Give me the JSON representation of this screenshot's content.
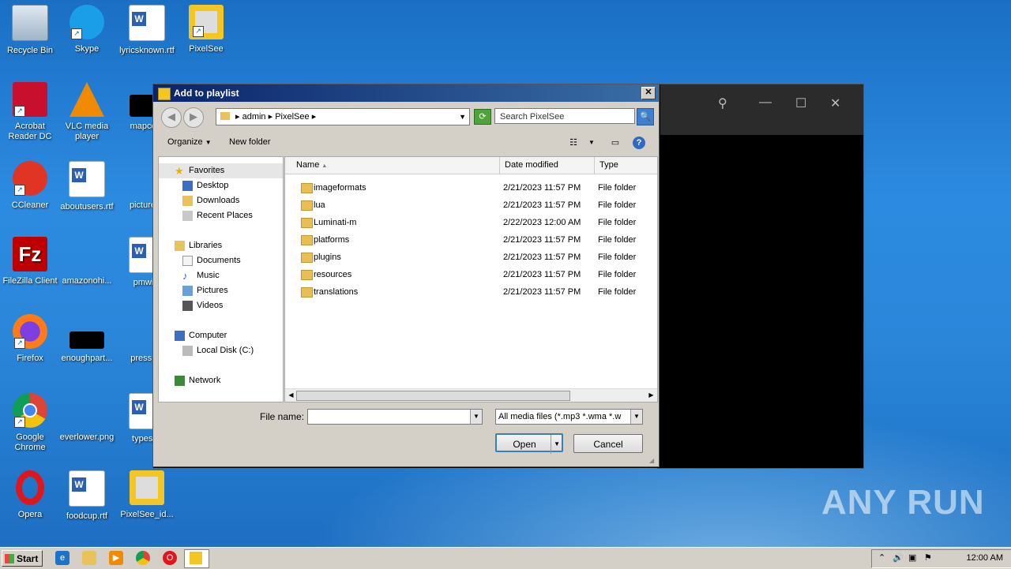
{
  "desktop": {
    "icons": [
      {
        "label": "Recycle Bin",
        "icon": "recycle-bin-icon"
      },
      {
        "label": "Skype",
        "icon": "skype-icon"
      },
      {
        "label": "lyricsknown.rtf",
        "icon": "word-doc-icon"
      },
      {
        "label": "PixelSee",
        "icon": "pixelsee-icon"
      },
      {
        "label": "Acrobat Reader DC",
        "icon": "acrobat-icon"
      },
      {
        "label": "VLC media player",
        "icon": "vlc-icon"
      },
      {
        "label": "mapcorp",
        "icon": "black-thumbnail-icon"
      },
      {
        "label": "CCleaner",
        "icon": "ccleaner-icon"
      },
      {
        "label": "aboutusers.rtf",
        "icon": "word-doc-icon"
      },
      {
        "label": "picturess",
        "icon": "image-icon"
      },
      {
        "label": "FileZilla Client",
        "icon": "filezilla-icon"
      },
      {
        "label": "amazonohi...",
        "icon": "image-icon"
      },
      {
        "label": "pmwith",
        "icon": "word-doc-icon"
      },
      {
        "label": "Firefox",
        "icon": "firefox-icon"
      },
      {
        "label": "enoughpart...",
        "icon": "black-thumbnail-icon"
      },
      {
        "label": "presspal",
        "icon": "image-icon"
      },
      {
        "label": "Google Chrome",
        "icon": "chrome-icon"
      },
      {
        "label": "everlower.png",
        "icon": "image-icon"
      },
      {
        "label": "typesite",
        "icon": "word-doc-icon"
      },
      {
        "label": "Opera",
        "icon": "opera-icon"
      },
      {
        "label": "foodcup.rtf",
        "icon": "word-doc-icon"
      },
      {
        "label": "PixelSee_id...",
        "icon": "pixelsee-installer-icon"
      }
    ],
    "watermark": "ANY RUN"
  },
  "player": {
    "pin": "⚲",
    "minimize": "—",
    "maximize": "☐",
    "close": "✕"
  },
  "dialog": {
    "title": "Add to playlist",
    "close_glyph": "✕",
    "back": "◀",
    "forward": "▶",
    "breadcrumb": [
      "admin",
      "PixelSee"
    ],
    "breadcrumb_sep": "▸",
    "dropdown_glyph": "▼",
    "search_placeholder": "Search PixelSee",
    "search_glyph": "🔍",
    "refresh_glyph": "⟳",
    "toolbar": {
      "organize": "Organize",
      "new_folder": "New folder",
      "views_glyph": "☷",
      "preview_glyph": "▭",
      "help_glyph": "?"
    },
    "nav": {
      "favorites": "Favorites",
      "favorites_items": [
        "Desktop",
        "Downloads",
        "Recent Places"
      ],
      "libraries": "Libraries",
      "libraries_items": [
        "Documents",
        "Music",
        "Pictures",
        "Videos"
      ],
      "computer": "Computer",
      "computer_items": [
        "Local Disk (C:)"
      ],
      "network": "Network"
    },
    "columns": {
      "name": "Name",
      "date": "Date modified",
      "type": "Type",
      "sort_glyph": "▲"
    },
    "files": [
      {
        "name": "imageformats",
        "date": "2/21/2023 11:57 PM",
        "type": "File folder"
      },
      {
        "name": "lua",
        "date": "2/21/2023 11:57 PM",
        "type": "File folder"
      },
      {
        "name": "Luminati-m",
        "date": "2/22/2023 12:00 AM",
        "type": "File folder"
      },
      {
        "name": "platforms",
        "date": "2/21/2023 11:57 PM",
        "type": "File folder"
      },
      {
        "name": "plugins",
        "date": "2/21/2023 11:57 PM",
        "type": "File folder"
      },
      {
        "name": "resources",
        "date": "2/21/2023 11:57 PM",
        "type": "File folder"
      },
      {
        "name": "translations",
        "date": "2/21/2023 11:57 PM",
        "type": "File folder"
      }
    ],
    "file_name_label": "File name:",
    "file_name_value": "",
    "filter_value": "All media files (*.mp3 *.wma *.w",
    "open_label": "Open",
    "cancel_label": "Cancel"
  },
  "taskbar": {
    "start_label": "Start",
    "clock": "12:00 AM",
    "apps": [
      "ie-icon",
      "explorer-icon",
      "media-player-icon",
      "chrome-icon",
      "opera-icon",
      "pixelsee-icon"
    ]
  }
}
